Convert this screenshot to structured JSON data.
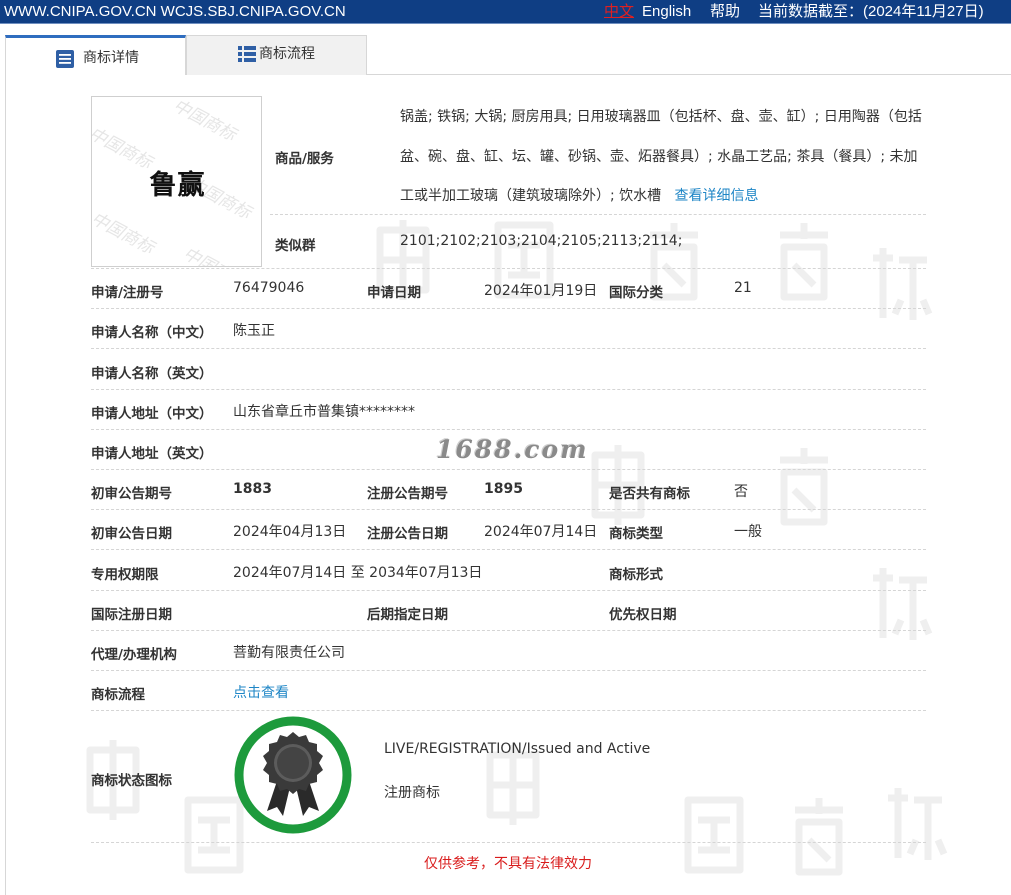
{
  "topbar": {
    "urls": "WWW.CNIPA.GOV.CN WCJS.SBJ.CNIPA.GOV.CN",
    "lang_zh": "中文",
    "lang_en": "English",
    "help": "帮助",
    "data_date": "当前数据截至：(2024年11月27日)",
    "bar_color": "#0f3e84"
  },
  "tabs": [
    {
      "label": "商标详情",
      "icon": "list-icon",
      "active": true
    },
    {
      "label": "商标流程",
      "icon": "grid-list-icon",
      "active": false
    }
  ],
  "logo": {
    "mark_text": "鲁赢"
  },
  "goods": {
    "label": "商品/服务",
    "text": "锅盖; 铁锅; 大锅; 厨房用具; 日用玻璃器皿（包括杯、盘、壶、缸）; 日用陶器（包括盆、碗、盘、缸、坛、罐、砂锅、壶、炻器餐具）; 水晶工艺品; 茶具（餐具）; 未加工或半加工玻璃（建筑玻璃除外）; 饮水槽",
    "link": "查看详细信息"
  },
  "similar_group": {
    "label": "类似群",
    "value": "2101;2102;2103;2104;2105;2113;2114;"
  },
  "fields": {
    "reg_no_label": "申请/注册号",
    "reg_no": "76479046",
    "apply_date_label": "申请日期",
    "apply_date": "2024年01月19日",
    "intl_class_label": "国际分类",
    "intl_class": "21",
    "applicant_cn_label": "申请人名称（中文）",
    "applicant_cn": "陈玉正",
    "applicant_en_label": "申请人名称（英文）",
    "applicant_en": "",
    "address_cn_label": "申请人地址（中文）",
    "address_cn": "山东省章丘市普集镇********",
    "address_en_label": "申请人地址（英文）",
    "address_en": "",
    "prelim_no_label": "初审公告期号",
    "prelim_no": "1883",
    "reg_pub_no_label": "注册公告期号",
    "reg_pub_no": "1895",
    "shared_label": "是否共有商标",
    "shared": "否",
    "prelim_date_label": "初审公告日期",
    "prelim_date": "2024年04月13日",
    "reg_pub_date_label": "注册公告日期",
    "reg_pub_date": "2024年07月14日",
    "mark_type_label": "商标类型",
    "mark_type": "一般",
    "exclusive_label": "专用权期限",
    "exclusive": "2024年07月14日 至 2034年07月13日",
    "mark_form_label": "商标形式",
    "mark_form": "",
    "intl_reg_date_label": "国际注册日期",
    "intl_reg_date": "",
    "later_design_label": "后期指定日期",
    "later_design": "",
    "priority_label": "优先权日期",
    "priority": "",
    "agent_label": "代理/办理机构",
    "agent": "菩勤有限责任公司",
    "flow_label": "商标流程",
    "flow_link": "点击查看"
  },
  "status": {
    "label": "商标状态图标",
    "en": "LIVE/REGISTRATION/Issued and Active",
    "cn": "注册商标",
    "icon": "award-ribbon-icon",
    "ring_color": "#1d9a3c"
  },
  "watermark": "1688.com",
  "disclaimer": "仅供参考，不具有法律效力"
}
